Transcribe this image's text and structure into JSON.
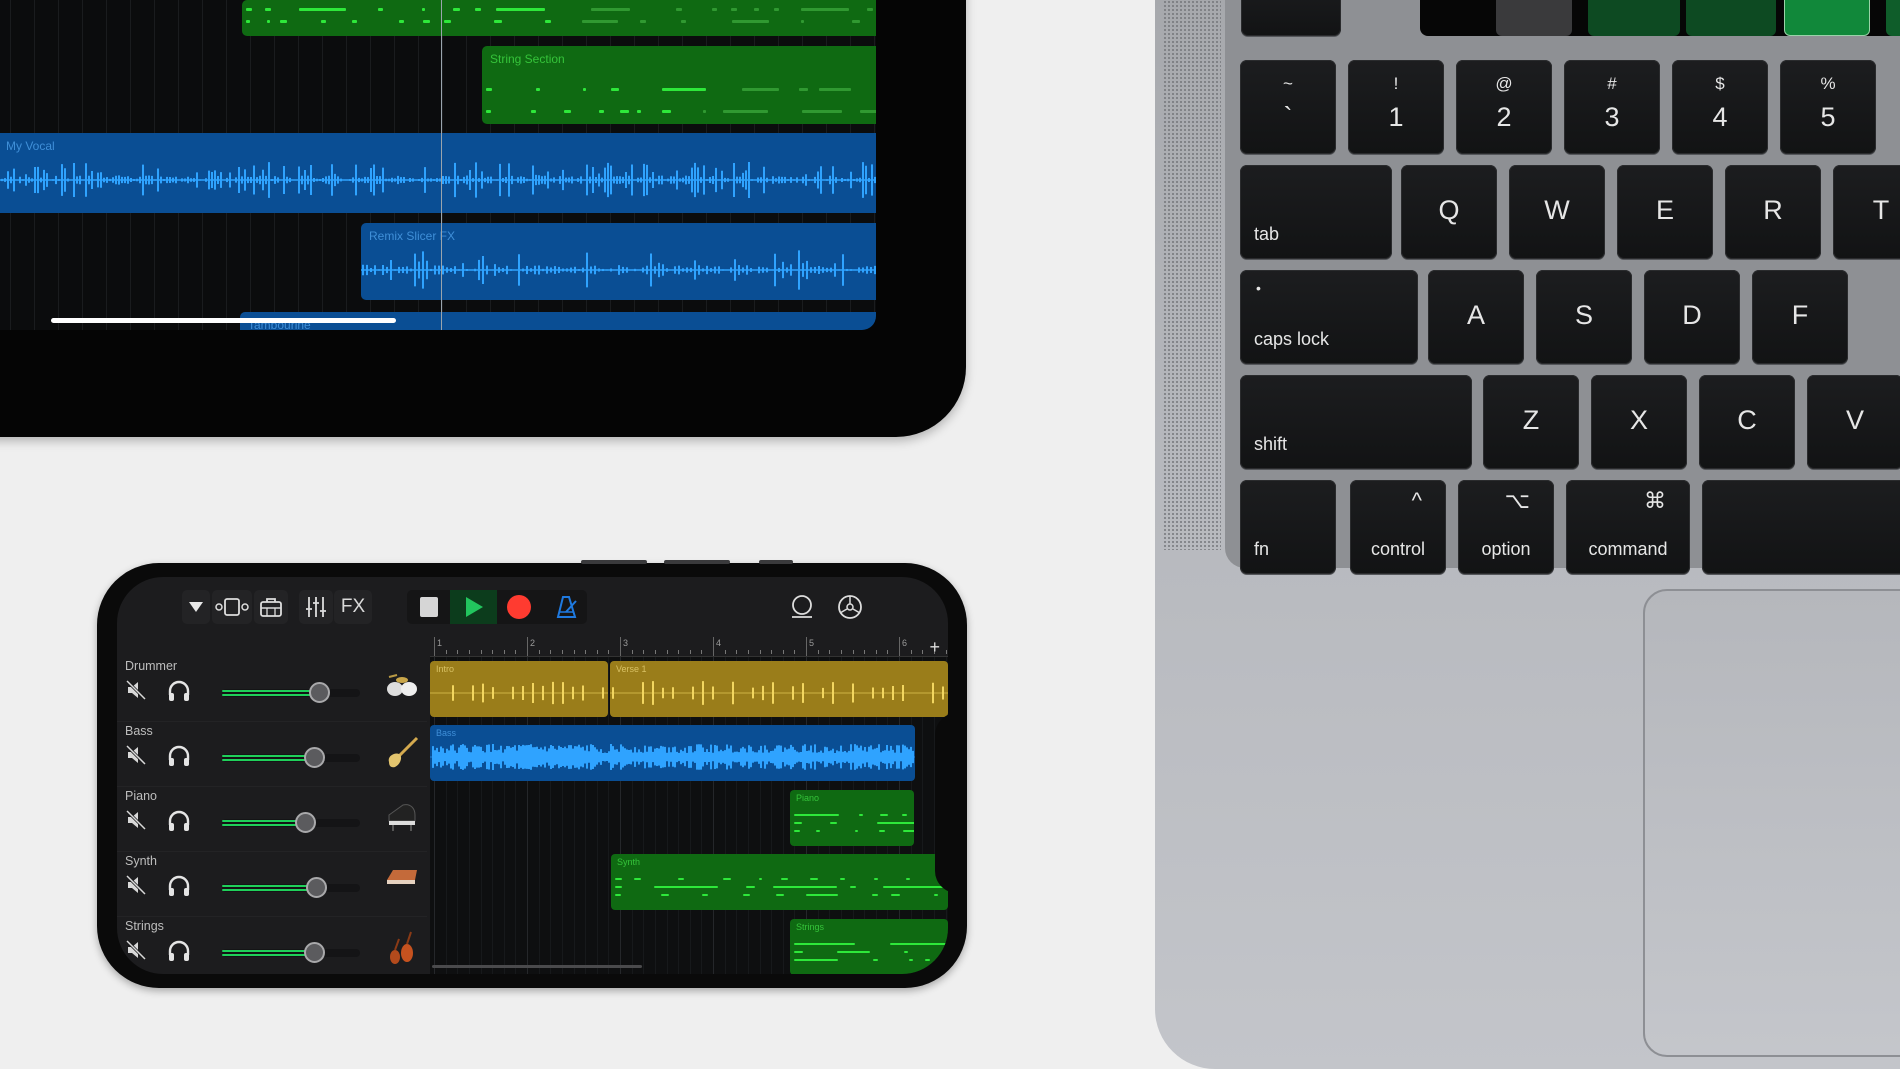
{
  "scene": {
    "description": "GarageBand on iPad, iPhone and MacBook keyboard",
    "background_color": "#efefef"
  },
  "ipad": {
    "regions": [
      {
        "name": "",
        "type": "midi",
        "color": "#0f6a12"
      },
      {
        "name": "String Section",
        "type": "midi",
        "color": "#0f6a12"
      },
      {
        "name": "My Vocal",
        "type": "audio",
        "color": "#0a4e94"
      },
      {
        "name": "Remix Slicer FX",
        "type": "audio",
        "color": "#0a4e94"
      },
      {
        "name": "Tambourine",
        "type": "audio",
        "color": "#0a4e94"
      }
    ],
    "scroll_position_fraction": 0.38
  },
  "iphone": {
    "toolbar": {
      "tracks_menu_icon": "triangle-down-icon",
      "view_toggle_icon": "track-view-icon",
      "browser_icon": "instrument-browser-icon",
      "mixer_icon": "mixer-sliders-icon",
      "fx_label": "FX",
      "stop_icon": "stop-icon",
      "play_icon": "play-icon",
      "record_icon": "record-icon",
      "metronome_icon": "metronome-icon",
      "loop_icon": "loop-browser-icon",
      "settings_icon": "settings-icon"
    },
    "colors": {
      "play": "#22c55e",
      "record": "#ff3b30",
      "metronome": "#1f7ae0",
      "volume": "#1fd05a"
    },
    "ruler": {
      "bars": [
        "1",
        "2",
        "3",
        "4",
        "5",
        "6"
      ],
      "add_label": "+"
    },
    "tracks": [
      {
        "name": "Drummer",
        "volume": 0.7,
        "icon": "drum-kit-icon"
      },
      {
        "name": "Bass",
        "volume": 0.67,
        "icon": "bass-guitar-icon"
      },
      {
        "name": "Piano",
        "volume": 0.6,
        "icon": "grand-piano-icon"
      },
      {
        "name": "Synth",
        "volume": 0.68,
        "icon": "synth-icon"
      },
      {
        "name": "Strings",
        "volume": 0.67,
        "icon": "violins-icon"
      }
    ],
    "regions": [
      {
        "track": "Drummer",
        "name": "Intro",
        "color": "#9a7d1a"
      },
      {
        "track": "Drummer",
        "name": "Verse 1",
        "color": "#9a7d1a"
      },
      {
        "track": "Bass",
        "name": "Bass",
        "color": "#0a4e94"
      },
      {
        "track": "Piano",
        "name": "Piano",
        "color": "#0f6a12"
      },
      {
        "track": "Synth",
        "name": "Synth",
        "color": "#0f6a12"
      },
      {
        "track": "Strings",
        "name": "Strings",
        "color": "#0f6a12"
      }
    ]
  },
  "macbook": {
    "touchbar_buttons": [
      {
        "color": "#3a3a3c"
      },
      {
        "color": "#0d4a22"
      },
      {
        "color": "#0d4a22"
      },
      {
        "color": "#11883a"
      },
      {
        "color": "#0f5d2a"
      },
      {
        "color": "#b32626"
      }
    ],
    "keys": {
      "row1": [
        {
          "top": "~",
          "main": "`"
        },
        {
          "top": "!",
          "main": "1"
        },
        {
          "top": "@",
          "main": "2"
        },
        {
          "top": "#",
          "main": "3"
        },
        {
          "top": "$",
          "main": "4"
        },
        {
          "top": "%",
          "main": "5"
        }
      ],
      "row2": {
        "mod": "tab",
        "letters": [
          "Q",
          "W",
          "E",
          "R",
          "T"
        ]
      },
      "row3": {
        "mod": "caps lock",
        "indicator": "•",
        "letters": [
          "A",
          "S",
          "D",
          "F"
        ]
      },
      "row4": {
        "mod": "shift",
        "letters": [
          "Z",
          "X",
          "C",
          "V"
        ]
      },
      "row5": [
        {
          "label": "fn",
          "symbol": ""
        },
        {
          "label": "control",
          "symbol": "^"
        },
        {
          "label": "option",
          "symbol": "⌥"
        },
        {
          "label": "command",
          "symbol": "⌘"
        }
      ]
    }
  }
}
